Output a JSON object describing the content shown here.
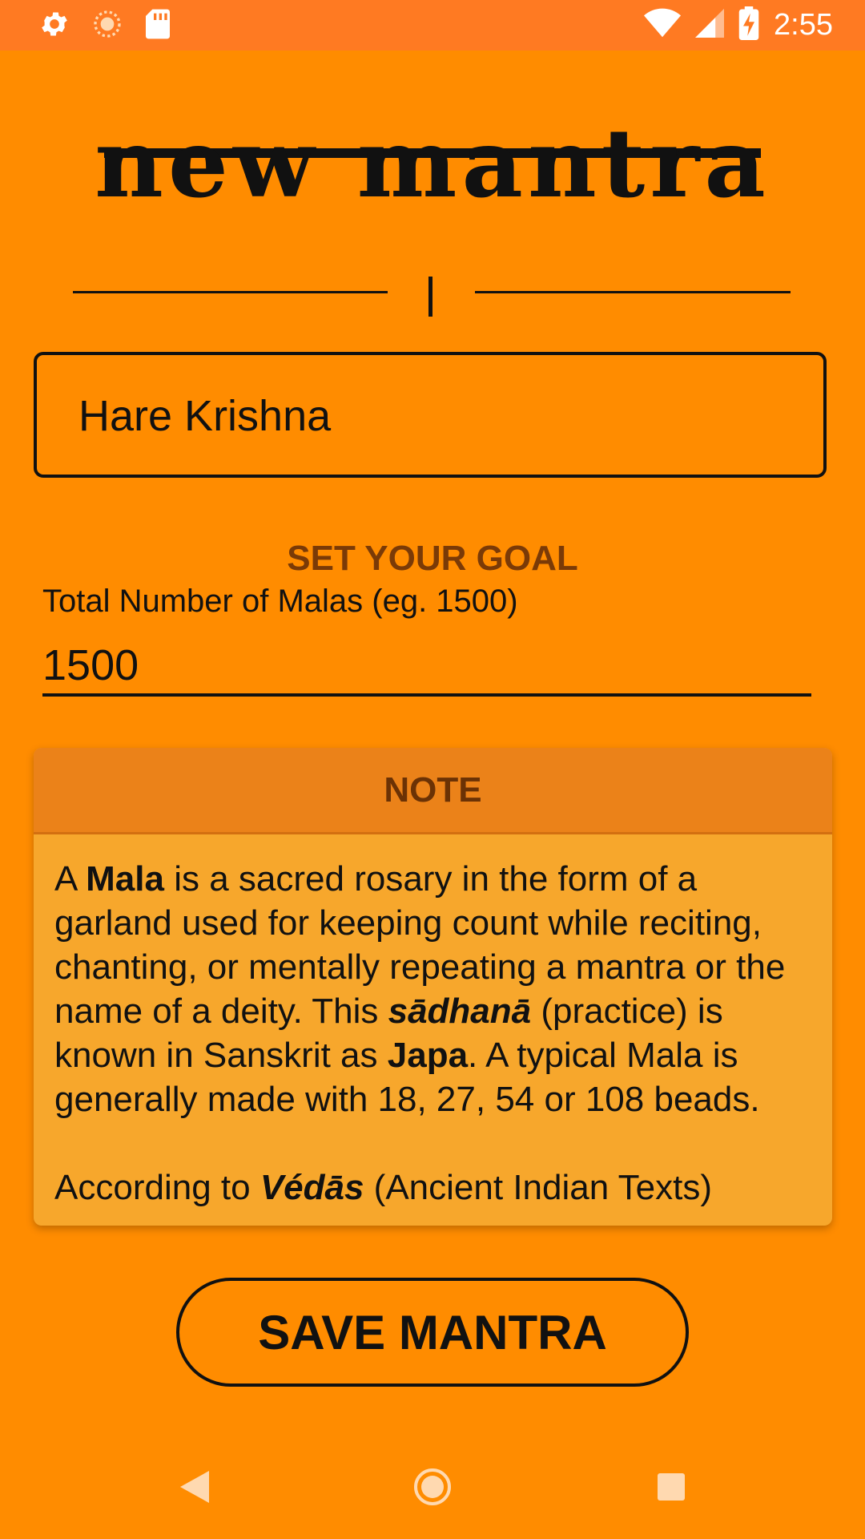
{
  "status_bar": {
    "time": "2:55",
    "icons": [
      "settings-icon",
      "sync-icon",
      "sd-card-icon",
      "wifi-icon",
      "signal-icon",
      "battery-charging-icon"
    ]
  },
  "header": {
    "title": "new mantra"
  },
  "mantra": {
    "value": "Hare Krishna",
    "placeholder": ""
  },
  "goal": {
    "heading": "SET YOUR GOAL",
    "label": "Total Number of Malas (eg. 1500)",
    "value": "1500"
  },
  "note": {
    "header": "NOTE",
    "p1": {
      "s1": "A ",
      "b1": "Mala",
      "s2": " is a sacred rosary in the form of a garland used for keeping count while reciting, chanting, or mentally repeating a mantra or the name of a deity. This ",
      "bi1": "sādhanā",
      "s3": " (practice) is known in Sanskrit as ",
      "b2": "Japa",
      "s4": ". A typical Mala is generally made with 18, 27, 54 or 108 beads."
    },
    "p2": {
      "s1": "According to ",
      "bi1": "Védās",
      "s2": " (Ancient Indian Texts)"
    }
  },
  "actions": {
    "save_label": "SAVE MANTRA"
  },
  "nav": {
    "icons": [
      "back-icon",
      "home-icon",
      "recents-icon"
    ]
  },
  "colors": {
    "background": "#FF8C00",
    "status_bar": "#FF7A22",
    "note_header": "#EB8219",
    "note_body": "#F7A72C",
    "heading_brown": "#7A3A07"
  }
}
